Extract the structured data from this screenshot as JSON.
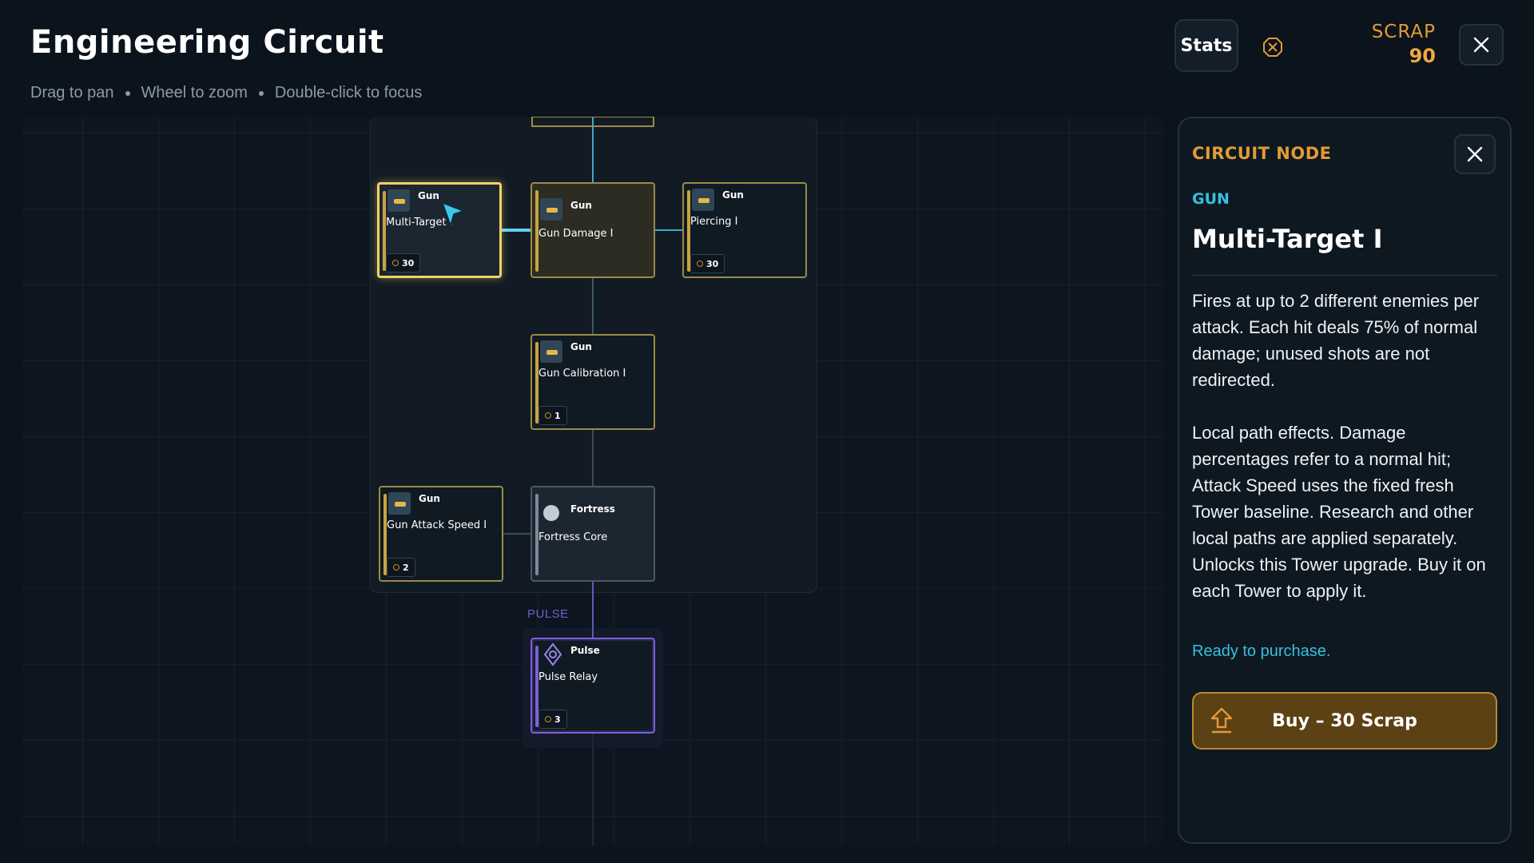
{
  "header": {
    "title": "Engineering Circuit",
    "hints": [
      "Drag to pan",
      "Wheel to zoom",
      "Double-click to focus"
    ],
    "stats_label": "Stats",
    "scrap_label": "SCRAP",
    "scrap_value": "90"
  },
  "canvas": {
    "pulse_heading": "PULSE",
    "nodes": [
      {
        "category": "Gun",
        "name": "Multi-Target I",
        "cost": "30",
        "state": "selected"
      },
      {
        "category": "Gun",
        "name": "Gun Damage I",
        "cost": "",
        "state": "owned"
      },
      {
        "category": "Gun",
        "name": "Piercing I",
        "cost": "30",
        "state": "available"
      },
      {
        "category": "Gun",
        "name": "Gun Calibration I",
        "cost": "1",
        "state": "available"
      },
      {
        "category": "Gun",
        "name": "Gun Attack Speed I",
        "cost": "2",
        "state": "available"
      },
      {
        "category": "Fortress",
        "name": "Fortress Core",
        "cost": "",
        "state": "core"
      },
      {
        "category": "Pulse",
        "name": "Pulse Relay",
        "cost": "3",
        "state": "available"
      }
    ]
  },
  "panel": {
    "heading": "CIRCUIT NODE",
    "category": "GUN",
    "title": "Multi-Target I",
    "description": "Fires at up to 2 different enemies per attack. Each hit deals 75% of normal damage; unused shots are not redirected.",
    "notes_1": "Local path effects. Damage percentages refer to a normal hit; Attack Speed uses the fixed fresh Tower baseline. Research and other local paths are applied separately.",
    "notes_2": "Unlocks this Tower upgrade. Buy it on each Tower to apply it.",
    "status": "Ready to purchase.",
    "buy_label": "Buy – 30 Scrap"
  },
  "colors": {
    "accent_orange": "#e39a35",
    "accent_cyan": "#37c0e0",
    "selected_outline": "#f2d168",
    "pulse_purple": "#7b61d9"
  }
}
